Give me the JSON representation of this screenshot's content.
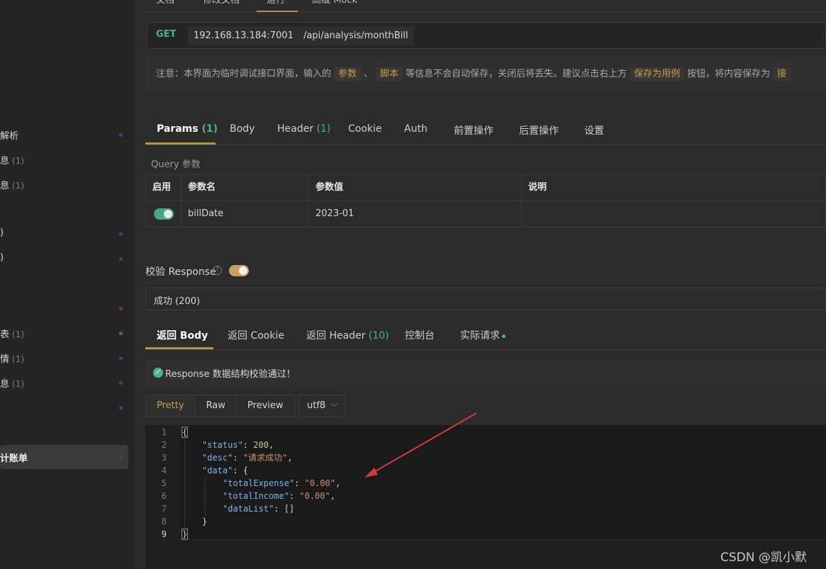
{
  "sidebar": {
    "items": [
      {
        "label": "解析",
        "count": "",
        "dot": "#2c4c86"
      },
      {
        "label": "息",
        "count": "(1)",
        "dot": ""
      },
      {
        "label": "息",
        "count": "(1)",
        "dot": ""
      },
      {
        "label": ")",
        "count": "",
        "dot": "#2c4c86"
      },
      {
        "label": ")",
        "count": "",
        "dot": "#2c4c86"
      },
      {
        "label": "",
        "count": "",
        "dot": "#7a3a3a"
      },
      {
        "label": "表",
        "count": "(1)",
        "dot": "#7a5a3a"
      },
      {
        "label": "情",
        "count": "(1)",
        "dot": "#2c4c86"
      },
      {
        "label": "息",
        "count": "(1)",
        "dot": "#2c4c86"
      },
      {
        "label": "",
        "count": "",
        "dot": "#2c4c86"
      },
      {
        "label": "计账单",
        "count": "",
        "dot": "#2c4c86"
      }
    ]
  },
  "top_tabs": [
    "文档",
    "修改文档",
    "运行",
    "高级 Mock"
  ],
  "url": {
    "method": "GET",
    "host": "192.168.13.184:7001",
    "path": "/api/analysis/monthBill"
  },
  "notice": {
    "prefix": "注意：本界面为临时调试接口界面，输入的",
    "hl1": "参数",
    "sep": "、",
    "hl2": "脚本",
    "mid": "等信息不会自动保存，关闭后将丢失。建议点击右上方",
    "hl3": "保存为用例",
    "suffix": "按钮，将内容保存为",
    "hl4": "接"
  },
  "request_tabs": [
    {
      "label": "Params",
      "num": "(1)"
    },
    {
      "label": "Body",
      "num": ""
    },
    {
      "label": "Header",
      "num": "(1)"
    },
    {
      "label": "Cookie",
      "num": ""
    },
    {
      "label": "Auth",
      "num": ""
    },
    {
      "label": "前置操作",
      "num": ""
    },
    {
      "label": "后置操作",
      "num": ""
    },
    {
      "label": "设置",
      "num": ""
    }
  ],
  "query": {
    "title": "Query 参数",
    "headers": [
      "启用",
      "参数名",
      "参数值",
      "说明"
    ],
    "rows": [
      {
        "enabled": true,
        "name": "billDate",
        "value": "2023-01",
        "desc": ""
      }
    ]
  },
  "validate": {
    "label": "校验 Response",
    "help": "?",
    "enabled": true,
    "status": "成功 (200)"
  },
  "response_tabs": [
    {
      "label": "返回 Body",
      "num": ""
    },
    {
      "label": "返回 Cookie",
      "num": ""
    },
    {
      "label": "返回 Header",
      "num": "(10)"
    },
    {
      "label": "控制台",
      "num": ""
    },
    {
      "label": "实际请求",
      "num": ""
    }
  ],
  "success_msg": "Response 数据结构校验通过！",
  "view_buttons": [
    "Pretty",
    "Raw",
    "Preview"
  ],
  "encoding": "utf8",
  "code": {
    "line_numbers": [
      "1",
      "2",
      "3",
      "4",
      "5",
      "6",
      "7",
      "8",
      "9"
    ],
    "k_status": "\"status\"",
    "v_status": "200",
    "k_desc": "\"desc\"",
    "v_desc": "\"请求成功\"",
    "k_data": "\"data\"",
    "k_totalExpense": "\"totalExpense\"",
    "v_totalExpense": "\"0.00\"",
    "k_totalIncome": "\"totalIncome\"",
    "v_totalIncome": "\"0.00\"",
    "k_dataList": "\"dataList\"",
    "v_dataList": "[]"
  },
  "watermark": "CSDN @凯小默",
  "colors": {
    "accent": "#b7904d",
    "green": "#49b38b",
    "annotation": "#d9363e"
  }
}
